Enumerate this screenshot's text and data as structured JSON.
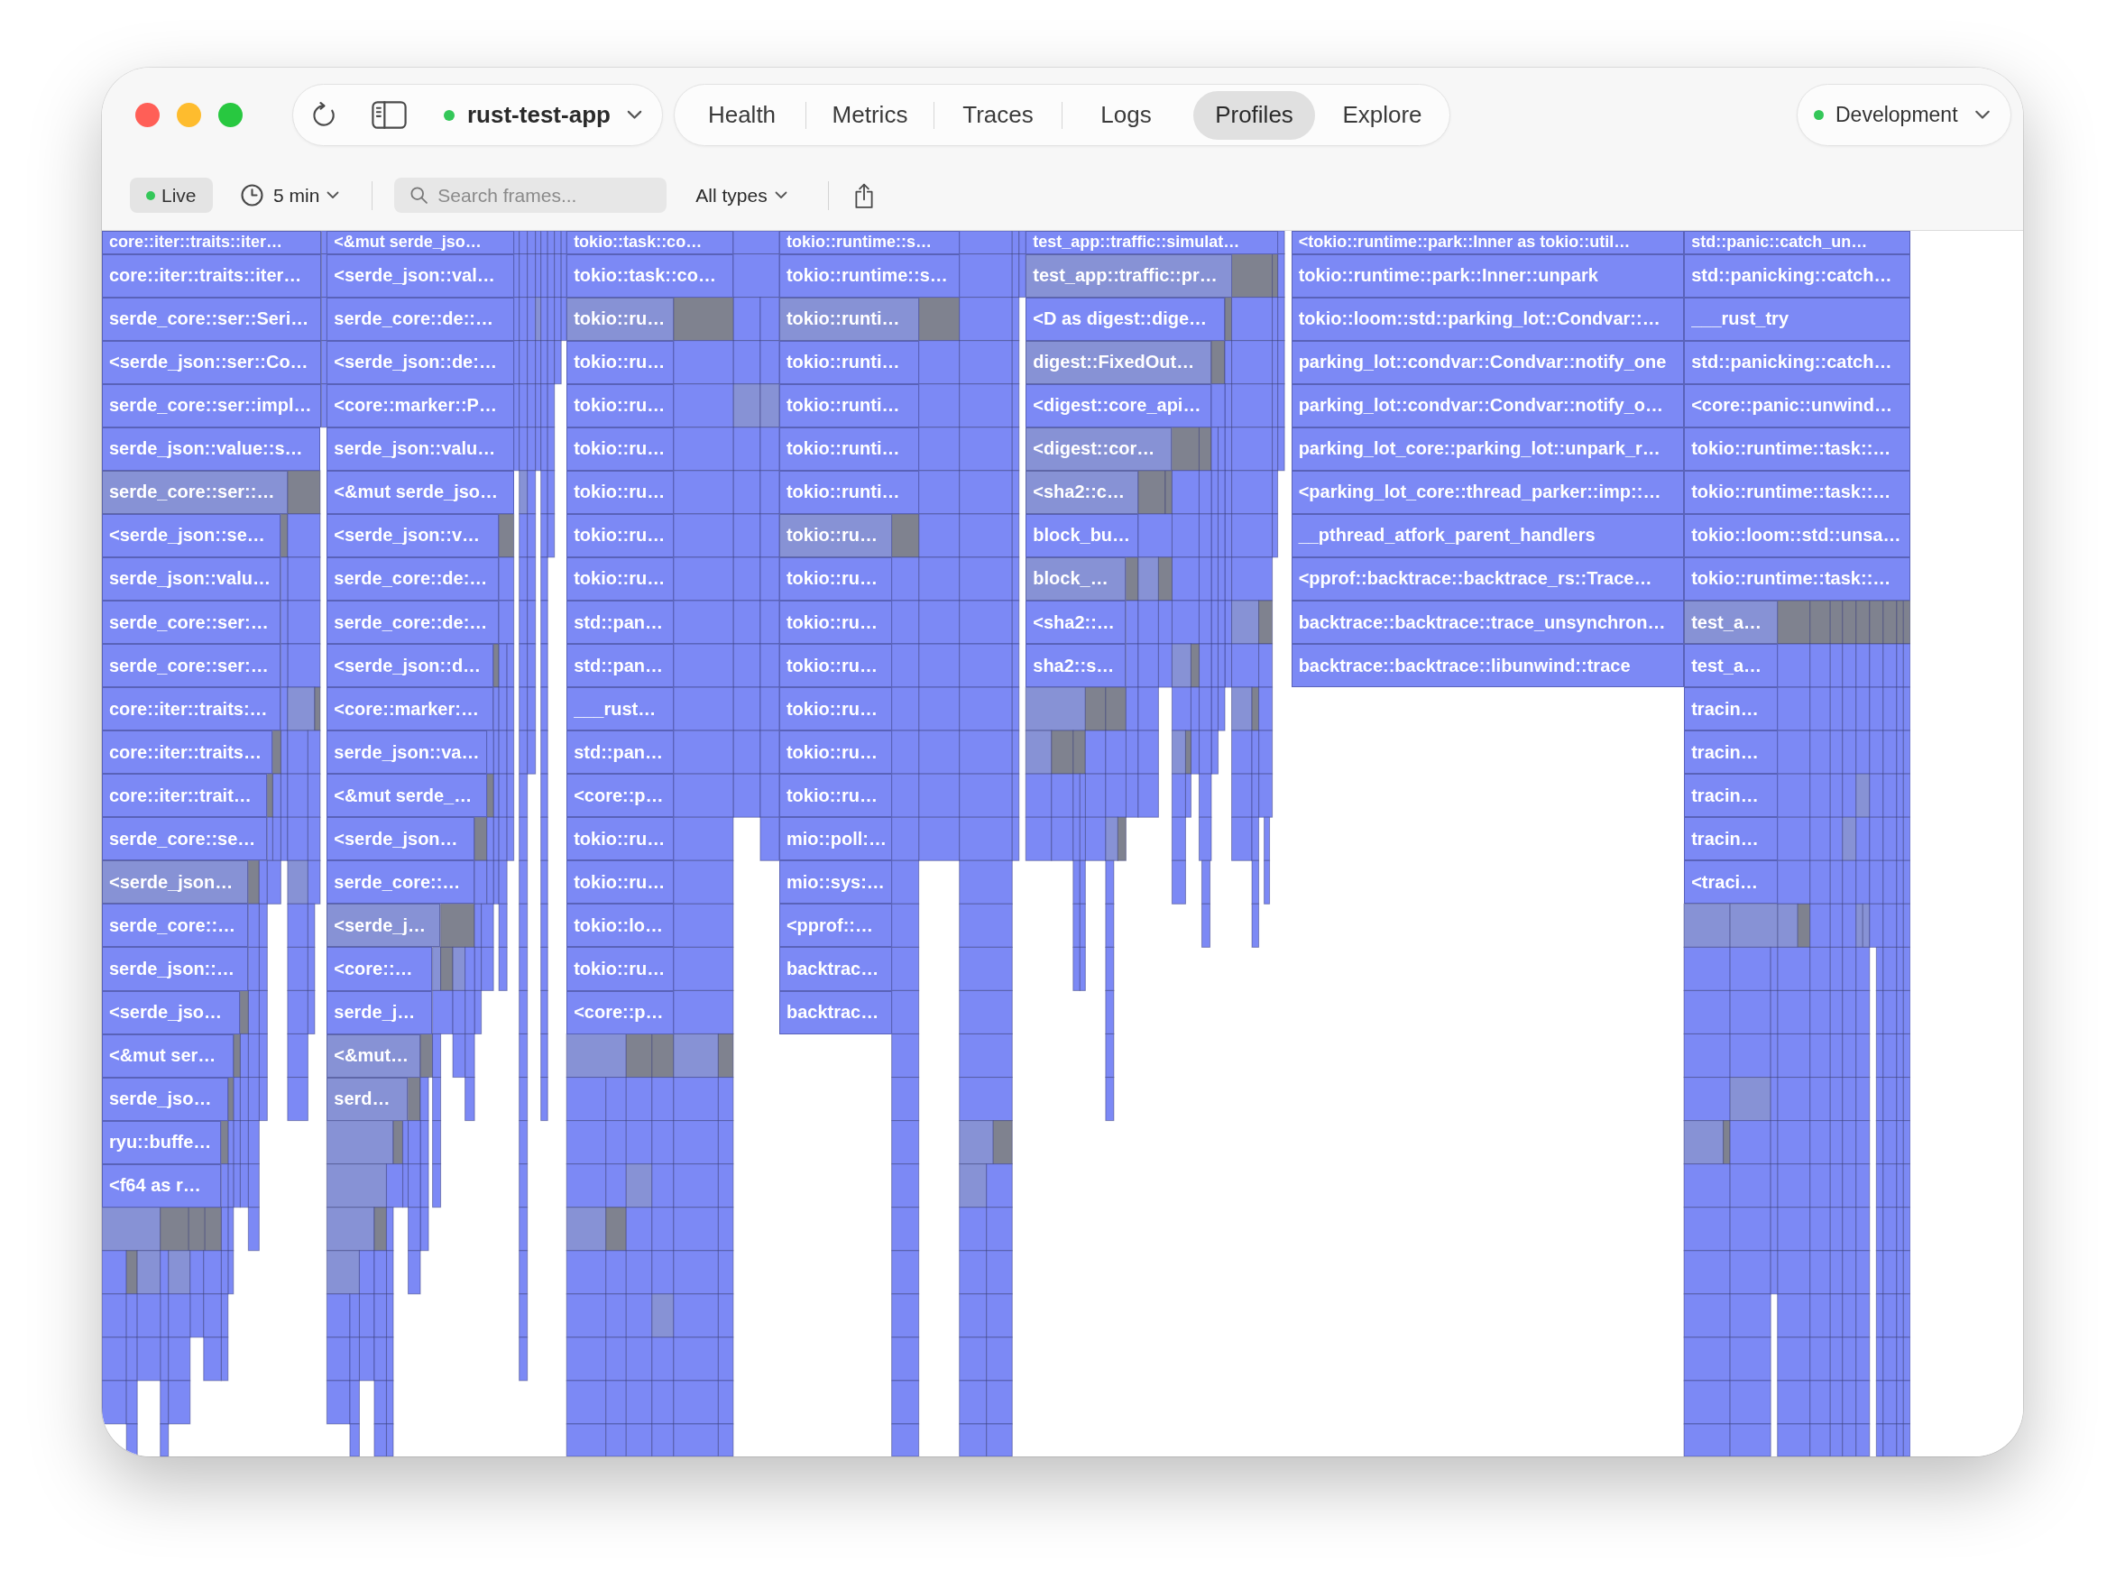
{
  "toolbar": {
    "app": {
      "name": "rust-test-app"
    },
    "tabs": [
      {
        "label": "Health",
        "selected": false
      },
      {
        "label": "Metrics",
        "selected": false
      },
      {
        "label": "Traces",
        "selected": false
      },
      {
        "label": "Logs",
        "selected": false
      },
      {
        "label": "Profiles",
        "selected": true
      },
      {
        "label": "Explore",
        "selected": false
      }
    ],
    "environment": {
      "name": "Development"
    }
  },
  "filter_bar": {
    "live": {
      "label": "Live",
      "on": true
    },
    "time_range": {
      "label": "5 min"
    },
    "search": {
      "placeholder": "Search frames..."
    },
    "type_filter": {
      "label": "All types"
    }
  },
  "flame_graph": {
    "stacks": [
      {
        "frames": [
          {
            "label": "core::iter::traits::iter…",
            "color": "#7c89f5"
          },
          {
            "label": "core::iter::traits::iter…",
            "color": "#7c89f5"
          },
          {
            "label": "serde_core::ser::Seri…",
            "color": "#7c89f5"
          },
          {
            "label": "<serde_json::ser::Co…",
            "color": "#7c89f5"
          },
          {
            "label": "serde_core::ser::impl…",
            "color": "#7c89f5"
          },
          {
            "label": "serde_json::value::s…",
            "color": "#7c89f5"
          },
          {
            "label": "serde_core::ser::…",
            "color": "#8792d5"
          },
          {
            "label": "<serde_json::se…",
            "color": "#7c89f5"
          },
          {
            "label": "serde_json::valu…",
            "color": "#7c89f5"
          },
          {
            "label": "serde_core::ser:…",
            "color": "#7c89f5"
          },
          {
            "label": "serde_core::ser:…",
            "color": "#7c89f5"
          },
          {
            "label": "core::iter::traits:…",
            "color": "#7c89f5"
          },
          {
            "label": "core::iter::traits…",
            "color": "#7c89f5"
          },
          {
            "label": "core::iter::trait…",
            "color": "#7c89f5"
          },
          {
            "label": "serde_core::se…",
            "color": "#7c89f5"
          },
          {
            "label": "<serde_json…",
            "color": "#8792d5"
          },
          {
            "label": "serde_core::…",
            "color": "#7c89f5"
          },
          {
            "label": "serde_json::…",
            "color": "#7c89f5"
          },
          {
            "label": "<serde_jso…",
            "color": "#7c89f5"
          },
          {
            "label": "<&mut ser…",
            "color": "#7c89f5"
          },
          {
            "label": "serde_jso…",
            "color": "#7c89f5"
          },
          {
            "label": "ryu::buffe…",
            "color": "#7c89f5"
          },
          {
            "label": "<f64 as r…",
            "color": "#7c89f5"
          }
        ]
      },
      {
        "frames": [
          {
            "label": "<&mut serde_jso…",
            "color": "#7c89f5"
          },
          {
            "label": "<serde_json::val…",
            "color": "#7c89f5"
          },
          {
            "label": "serde_core::de::…",
            "color": "#7c89f5"
          },
          {
            "label": "<serde_json::de:…",
            "color": "#7c89f5"
          },
          {
            "label": "<core::marker::P…",
            "color": "#7c89f5"
          },
          {
            "label": "serde_json::valu…",
            "color": "#7c89f5"
          },
          {
            "label": "<&mut serde_jso…",
            "color": "#7c89f5"
          },
          {
            "label": "<serde_json::v…",
            "color": "#7c89f5"
          },
          {
            "label": "serde_core::de:…",
            "color": "#7c89f5"
          },
          {
            "label": "serde_core::de:…",
            "color": "#7c89f5"
          },
          {
            "label": "<serde_json::d…",
            "color": "#7c89f5"
          },
          {
            "label": "<core::marker:…",
            "color": "#7c89f5"
          },
          {
            "label": "serde_json::va…",
            "color": "#7c89f5"
          },
          {
            "label": "<&mut serde_…",
            "color": "#7c89f5"
          },
          {
            "label": "<serde_json…",
            "color": "#7c89f5"
          },
          {
            "label": "serde_core::…",
            "color": "#7c89f5"
          },
          {
            "label": "<serde_j…",
            "color": "#8792d5"
          },
          {
            "label": "<core::…",
            "color": "#7c89f5"
          },
          {
            "label": "serde_j…",
            "color": "#7c89f5"
          },
          {
            "label": "<&mut…",
            "color": "#8792d5"
          },
          {
            "label": "serd…",
            "color": "#8792d5"
          }
        ]
      },
      {
        "frames": [
          {
            "label": "tokio::task::co…",
            "color": "#7c89f5"
          },
          {
            "label": "tokio::task::co…",
            "color": "#7c89f5"
          },
          {
            "label": "tokio::ru…",
            "color": "#8792d5"
          },
          {
            "label": "tokio::ru…",
            "color": "#7c89f5"
          },
          {
            "label": "tokio::ru…",
            "color": "#7c89f5"
          },
          {
            "label": "tokio::ru…",
            "color": "#7c89f5"
          },
          {
            "label": "tokio::ru…",
            "color": "#7c89f5"
          },
          {
            "label": "tokio::ru…",
            "color": "#7c89f5"
          },
          {
            "label": "tokio::ru…",
            "color": "#7c89f5"
          },
          {
            "label": "std::pan…",
            "color": "#7c89f5"
          },
          {
            "label": "std::pan…",
            "color": "#7c89f5"
          },
          {
            "label": "___rust…",
            "color": "#7c89f5"
          },
          {
            "label": "std::pan…",
            "color": "#7c89f5"
          },
          {
            "label": "<core::p…",
            "color": "#7c89f5"
          },
          {
            "label": "tokio::ru…",
            "color": "#7c89f5"
          },
          {
            "label": "tokio::ru…",
            "color": "#7c89f5"
          },
          {
            "label": "tokio::lo…",
            "color": "#7c89f5"
          },
          {
            "label": "tokio::ru…",
            "color": "#7c89f5"
          },
          {
            "label": "<core::p…",
            "color": "#7c89f5"
          }
        ]
      },
      {
        "frames": [
          {
            "label": "tokio::runtime::s…",
            "color": "#7c89f5"
          },
          {
            "label": "tokio::runtime::s…",
            "color": "#7c89f5"
          },
          {
            "label": "tokio::runti…",
            "color": "#8792d5"
          },
          {
            "label": "tokio::runti…",
            "color": "#7c89f5"
          },
          {
            "label": "tokio::runti…",
            "color": "#7c89f5"
          },
          {
            "label": "tokio::runti…",
            "color": "#7c89f5"
          },
          {
            "label": "tokio::runti…",
            "color": "#7c89f5"
          },
          {
            "label": "tokio::ru…",
            "color": "#8792d5"
          },
          {
            "label": "tokio::ru…",
            "color": "#7c89f5"
          },
          {
            "label": "tokio::ru…",
            "color": "#7c89f5"
          },
          {
            "label": "tokio::ru…",
            "color": "#7c89f5"
          },
          {
            "label": "tokio::ru…",
            "color": "#7c89f5"
          },
          {
            "label": "tokio::ru…",
            "color": "#7c89f5"
          },
          {
            "label": "tokio::ru…",
            "color": "#7c89f5"
          },
          {
            "label": "mio::poll:…",
            "color": "#7c89f5"
          },
          {
            "label": "mio::sys:…",
            "color": "#7c89f5"
          },
          {
            "label": "<pprof::…",
            "color": "#7c89f5"
          },
          {
            "label": "backtrac…",
            "color": "#7c89f5"
          },
          {
            "label": "backtrac…",
            "color": "#7c89f5"
          }
        ]
      },
      {
        "frames": [
          {
            "label": "test_app::traffic::simulat…",
            "color": "#7c89f5"
          },
          {
            "label": "test_app::traffic::pr…",
            "color": "#8792d5"
          },
          {
            "label": "<D as digest::dige…",
            "color": "#7c89f5"
          },
          {
            "label": "digest::FixedOut…",
            "color": "#8792d5"
          },
          {
            "label": "<digest::core_api…",
            "color": "#7c89f5"
          },
          {
            "label": "<digest::cor…",
            "color": "#8792d5"
          },
          {
            "label": "<sha2::c…",
            "color": "#8792d5"
          },
          {
            "label": "block_bu…",
            "color": "#7c89f5"
          },
          {
            "label": "block_…",
            "color": "#8792d5"
          },
          {
            "label": "<sha2::…",
            "color": "#7c89f5"
          },
          {
            "label": "sha2::s…",
            "color": "#7c89f5"
          }
        ]
      },
      {
        "frames": [
          {
            "label": "<tokio::runtime::park::Inner as tokio::util…",
            "color": "#7c89f5"
          },
          {
            "label": "tokio::runtime::park::Inner::unpark",
            "color": "#7c89f5"
          },
          {
            "label": "tokio::loom::std::parking_lot::Condvar::…",
            "color": "#7c89f5"
          },
          {
            "label": "parking_lot::condvar::Condvar::notify_one",
            "color": "#7c89f5"
          },
          {
            "label": "parking_lot::condvar::Condvar::notify_o…",
            "color": "#7c89f5"
          },
          {
            "label": "parking_lot_core::parking_lot::unpark_r…",
            "color": "#7c89f5"
          },
          {
            "label": "<parking_lot_core::thread_parker::imp::…",
            "color": "#7c89f5"
          },
          {
            "label": "__pthread_atfork_parent_handlers",
            "color": "#7c89f5"
          },
          {
            "label": "<pprof::backtrace::backtrace_rs::Trace…",
            "color": "#7c89f5"
          },
          {
            "label": "backtrace::backtrace::trace_unsynchron…",
            "color": "#7c89f5"
          },
          {
            "label": "backtrace::backtrace::libunwind::trace",
            "color": "#7c89f5"
          }
        ]
      },
      {
        "frames": [
          {
            "label": "std::panic::catch_un…",
            "color": "#7c89f5"
          },
          {
            "label": "std::panicking::catch…",
            "color": "#7c89f5"
          },
          {
            "label": "___rust_try",
            "color": "#7c89f5"
          },
          {
            "label": "std::panicking::catch…",
            "color": "#7c89f5"
          },
          {
            "label": "<core::panic::unwind…",
            "color": "#7c89f5"
          },
          {
            "label": "tokio::runtime::task::…",
            "color": "#7c89f5"
          },
          {
            "label": "tokio::runtime::task::…",
            "color": "#7c89f5"
          },
          {
            "label": "tokio::loom::std::unsa…",
            "color": "#7c89f5"
          },
          {
            "label": "tokio::runtime::task::…",
            "color": "#7c89f5"
          },
          {
            "label": "test_a…",
            "color": "#8792d5"
          },
          {
            "label": "test_a…",
            "color": "#7c89f5"
          },
          {
            "label": "tracin…",
            "color": "#7c89f5"
          },
          {
            "label": "tracin…",
            "color": "#7c89f5"
          },
          {
            "label": "tracin…",
            "color": "#7c89f5"
          },
          {
            "label": "tracin…",
            "color": "#7c89f5"
          },
          {
            "label": "<traci…",
            "color": "#7c89f5"
          }
        ]
      }
    ]
  }
}
